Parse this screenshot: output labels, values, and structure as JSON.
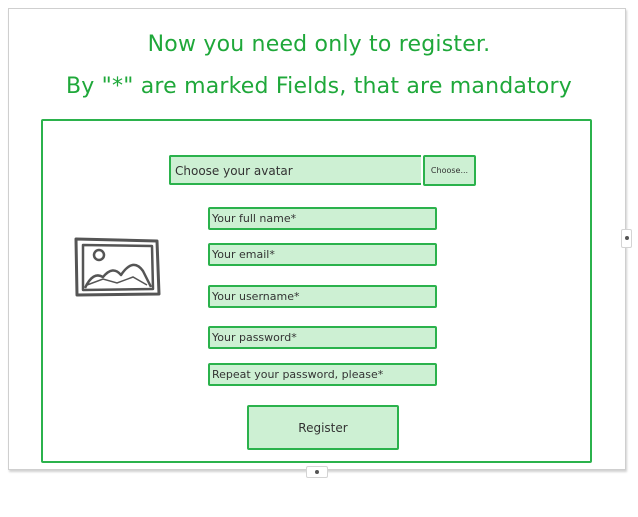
{
  "heading": {
    "line1": "Now you need only to register.",
    "line2": "By \"*\" are marked Fields, that are mandatory"
  },
  "avatar": {
    "placeholder": "Choose your avatar",
    "choose_label": "Choose..."
  },
  "fields": {
    "full_name": "Your full name*",
    "email": "Your email*",
    "username": "Your username*",
    "password": "Your password*",
    "repeat_password": "Repeat your password, please*"
  },
  "register_label": "Register",
  "colors": {
    "accent": "#2bb24c",
    "heading": "#1fa83a",
    "field_fill": "#cdf0d3",
    "icon_stroke": "#555555"
  },
  "icons": {
    "avatar_preview": "image-icon"
  }
}
